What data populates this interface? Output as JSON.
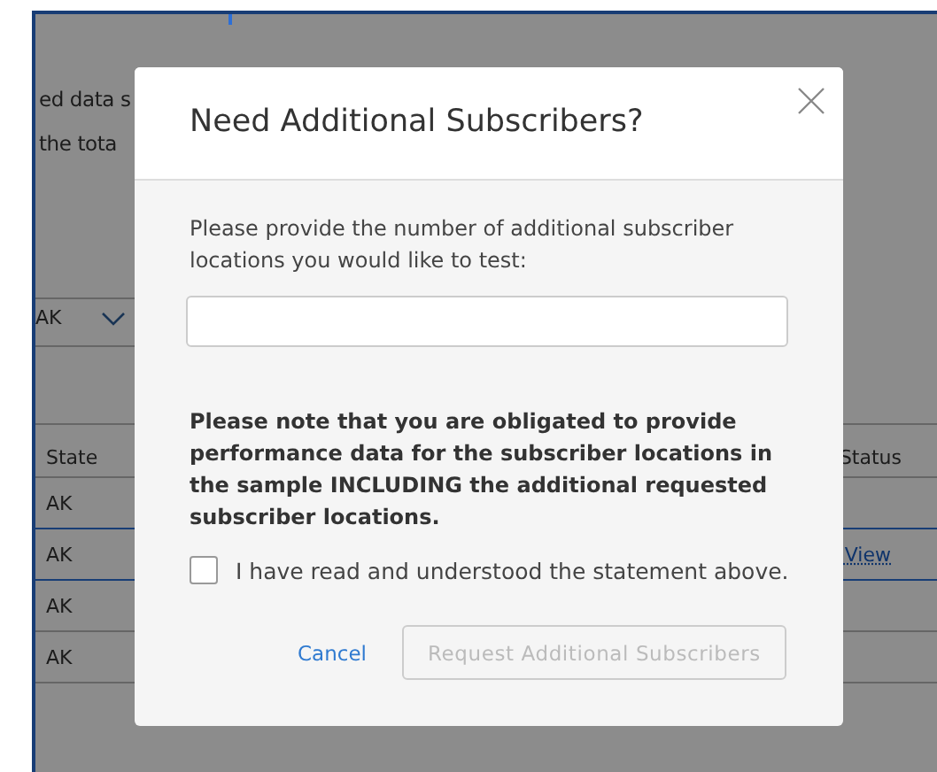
{
  "background": {
    "intro_lines": [
      "ed data s",
      "the tota"
    ],
    "filter": {
      "value": "AK"
    },
    "table": {
      "columns": [
        "State",
        "Status"
      ],
      "rows": [
        {
          "state": "AK",
          "selected": false
        },
        {
          "state": "AK",
          "status_link": "View",
          "selected": true
        },
        {
          "state": "AK",
          "selected": false
        },
        {
          "state": "AK",
          "selected": false
        }
      ]
    }
  },
  "dialog": {
    "title": "Need Additional Subscribers?",
    "prompt": "Please provide the number of additional subscriber locations you would like to test:",
    "note": "Please note that you are obligated to provide performance data for the subscriber locations in the sample INCLUDING the additional requested subscriber locations.",
    "acknowledge": {
      "label": "I have read and understood the statement above.",
      "checked": false
    },
    "buttons": [
      {
        "kind": "link",
        "label": "Cancel",
        "disabled": false
      },
      {
        "kind": "outline",
        "label": "Request Additional Subscribers",
        "disabled": true
      }
    ]
  }
}
